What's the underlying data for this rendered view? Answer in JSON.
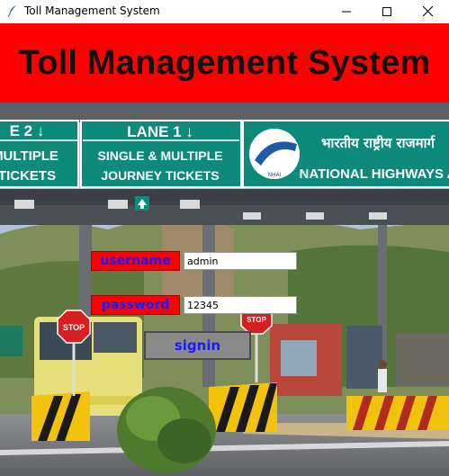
{
  "window": {
    "title": "Toll Management System",
    "icons": [
      "feather-icon",
      "minimize-icon",
      "maximize-icon",
      "close-icon"
    ]
  },
  "header": {
    "title": "Toll Management System",
    "color": "#ff0000"
  },
  "background_photo": {
    "signs": {
      "lane2_title": "E 2 ↓",
      "lane2_line1": "MULTIPLE",
      "lane2_line2": "TICKETS",
      "lane1_title": "LANE 1 ↓",
      "lane1_line1": "SINGLE & MULTIPLE",
      "lane1_line2": "JOURNEY TICKETS",
      "nh_hindi": "भारतीय राष्ट्रीय राजमार्ग",
      "nh_english": "NATIONAL HIGHWAYS A",
      "nh_logo": "NHAI"
    },
    "stop_sign_text": "STOP"
  },
  "form": {
    "username_label": "username",
    "username_value": "admin",
    "password_label": "password",
    "password_value": "12345",
    "signin_label": "signin",
    "label_color": "#ff0000",
    "text_color": "#1a1aff"
  }
}
